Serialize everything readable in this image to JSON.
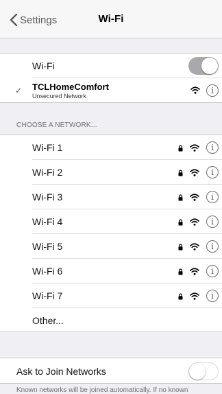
{
  "nav": {
    "back_label": "Settings",
    "title": "Wi-Fi"
  },
  "wifi_section": {
    "toggle_label": "Wi-Fi",
    "wifi_enabled": true,
    "connected": {
      "name": "TCLHomeComfort",
      "detail": "Unsecured Network"
    }
  },
  "networks": {
    "header": "CHOOSE A NETWORK...",
    "items": [
      {
        "name": "Wi-Fi 1",
        "locked": true,
        "icon": "wifi-signal-icon"
      },
      {
        "name": "Wi-Fi 2",
        "locked": true,
        "icon": "wifi-signal-icon"
      },
      {
        "name": "Wi-Fi 3",
        "locked": true,
        "icon": "wifi-signal-icon"
      },
      {
        "name": "Wi-Fi 4",
        "locked": true,
        "icon": "wifi-signal-icon"
      },
      {
        "name": "Wi-Fi 5",
        "locked": true,
        "icon": "wifi-signal-icon"
      },
      {
        "name": "Wi-Fi 6",
        "locked": true,
        "icon": "wifi-signal-icon"
      },
      {
        "name": "Wi-Fi 7",
        "locked": true,
        "icon": "wifi-signal-icon"
      }
    ],
    "other_label": "Other..."
  },
  "ask_section": {
    "label": "Ask to Join Networks",
    "enabled": false,
    "footer": "Known networks will be joined automatically. If no known"
  },
  "icons": {
    "checkmark": "✓",
    "info": "i"
  },
  "colors": {
    "toggle_on": "#a9a9ad",
    "background": "#efeff4",
    "separator": "#c8c7cc"
  }
}
